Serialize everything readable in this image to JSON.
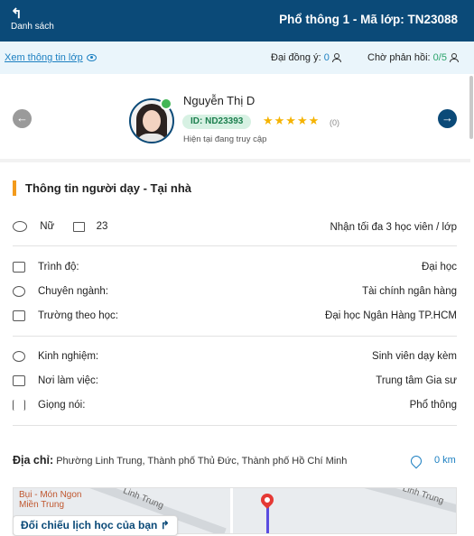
{
  "header": {
    "back_arrow": "↰",
    "back_label": "Danh sách",
    "title": "Phổ thông 1 - Mã lớp: TN23088",
    "background": "#0b4a78"
  },
  "subbar": {
    "view_info_link": "Xem thông tin lớp",
    "agreed_label": "Đại đồng ý:",
    "agreed_count": "0",
    "waiting_label": "Chờ phản hồi:",
    "waiting_count": "0/5"
  },
  "tutor": {
    "name": "Nguyễn Thị D",
    "id_badge": "ID: ND23393",
    "stars": "★★★★★",
    "rating_count": "(0)",
    "status": "Hiện tại đang truy cập",
    "nav_prev": "←",
    "nav_next": "→"
  },
  "section": {
    "title": "Thông tin người dạy - Tại nhà",
    "accent": "#f39b1c"
  },
  "basic": {
    "gender": "Nữ",
    "age": "23",
    "capacity": "Nhận tối đa 3 học viên / lớp"
  },
  "education": [
    {
      "label": "Trình độ:",
      "value": "Đại học",
      "icon": "book-icon"
    },
    {
      "label": "Chuyên ngành:",
      "value": "Tài chính ngân hàng",
      "icon": "major-icon"
    },
    {
      "label": "Trường theo học:",
      "value": "Đại học Ngân Hàng TP.HCM",
      "icon": "building-icon"
    }
  ],
  "work": [
    {
      "label": "Kinh nghiệm:",
      "value": "Sinh viên dạy kèm",
      "icon": "experience-icon"
    },
    {
      "label": "Nơi làm việc:",
      "value": "Trung tâm Gia sư",
      "icon": "briefcase-icon"
    },
    {
      "label": "Giọng nói:",
      "value": "Phổ thông",
      "icon": "voice-icon"
    }
  ],
  "address": {
    "label": "Địa chỉ:",
    "value": "Phường Linh Trung, Thành phố Thủ Đức, Thành phố Hồ Chí Minh",
    "distance": "0 km"
  },
  "map": {
    "poi": "Bụi - Món Ngon Miền Trung",
    "street_label_1": "Linh Trung",
    "street_label_2": "Linh Trung"
  },
  "compare_button": "Đối chiếu lịch học của bạn ↱"
}
